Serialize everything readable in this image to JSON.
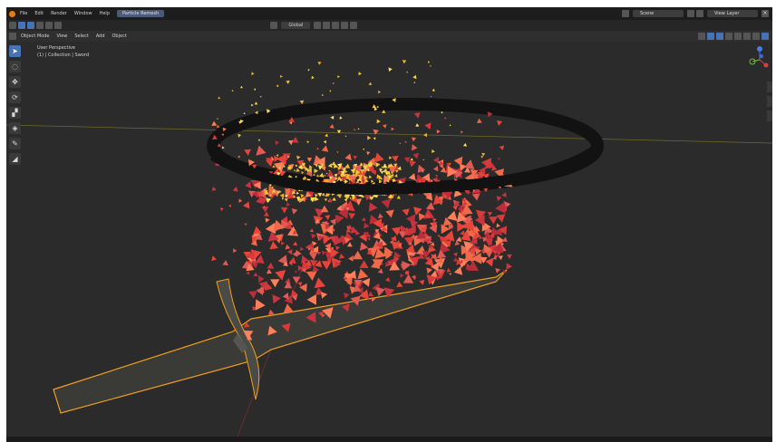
{
  "topbar": {
    "menus": [
      "File",
      "Edit",
      "Render",
      "Window",
      "Help"
    ],
    "workspace_tab": "Particle Remesh",
    "scene_label": "Scene",
    "view_layer_label": "View Layer"
  },
  "toolbar": {
    "orientation_label": "Global"
  },
  "header": {
    "mode_label": "Object Mode",
    "menus": [
      "View",
      "Select",
      "Add",
      "Object"
    ]
  },
  "viewport": {
    "view_name": "User Perspective",
    "collection_info": "(1) | Collection | Sword"
  },
  "colors": {
    "background": "#2b2b2b",
    "header_bg": "#2f2f2f",
    "accent": "#4772b3",
    "selection_outline": "#f29f1c",
    "particle_red": "#e8453a",
    "particle_yellow": "#f4d23c",
    "ring": "#111111"
  },
  "left_tool_icons": [
    "cursor-select-icon",
    "select-box-icon",
    "move-icon",
    "rotate-icon",
    "scale-icon",
    "transform-icon",
    "annotate-icon",
    "measure-icon"
  ]
}
